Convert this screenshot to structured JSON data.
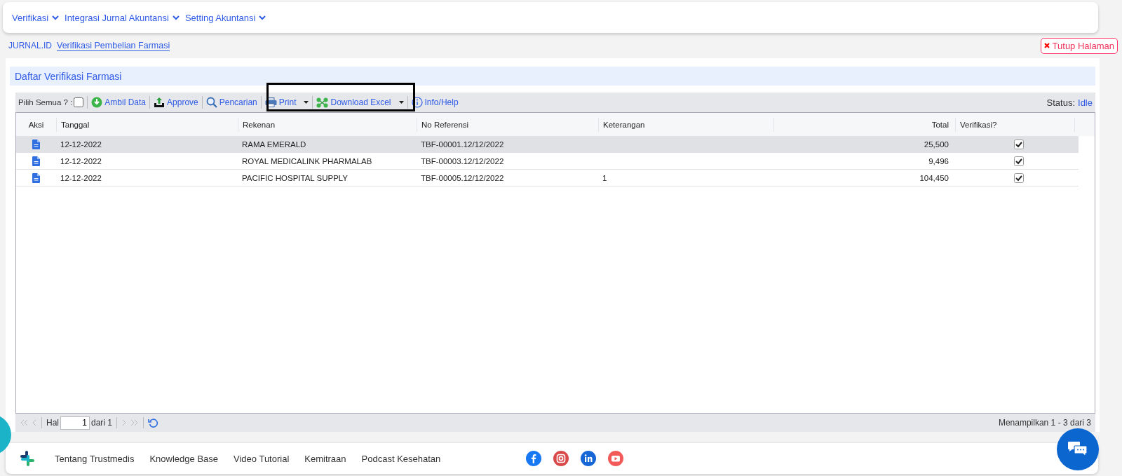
{
  "nav": {
    "menus": [
      {
        "label": "Verifikasi"
      },
      {
        "label": "Integrasi Jurnal Akuntansi"
      },
      {
        "label": "Setting Akuntansi"
      }
    ]
  },
  "breadcrumb": [
    {
      "label": "JURNAL.ID",
      "selected": false
    },
    {
      "label": "Verifikasi Pembelian Farmasi",
      "selected": true
    }
  ],
  "close_button": {
    "label": "Tutup Halaman"
  },
  "panel": {
    "title": "Daftar Verifikasi Farmasi",
    "select_all": {
      "label": "Pilih Semua ? :",
      "checked": false
    },
    "toolbar": [
      {
        "label": "Ambil Data",
        "dropdown": false
      },
      {
        "label": "Approve",
        "dropdown": false
      },
      {
        "label": "Pencarian",
        "dropdown": false
      },
      {
        "label": "Print",
        "dropdown": true
      },
      {
        "label": "Download Excel",
        "dropdown": true
      },
      {
        "label": "Info/Help",
        "dropdown": false
      }
    ],
    "status": {
      "label": "Status:",
      "value": "Idle"
    },
    "columns": [
      "Aksi",
      "Tanggal",
      "Rekenan",
      "No Referensi",
      "Keterangan",
      "Total",
      "Verifikasi?"
    ],
    "rows": [
      {
        "tanggal": "12-12-2022",
        "rekenan": "RAMA EMERALD",
        "no_referensi": "TBF-00001.12/12/2022",
        "keterangan": "",
        "total": "25,500",
        "verified": true,
        "selected": true
      },
      {
        "tanggal": "12-12-2022",
        "rekenan": "ROYAL MEDICALINK PHARMALAB",
        "no_referensi": "TBF-00003.12/12/2022",
        "keterangan": "",
        "total": "9,496",
        "verified": true,
        "selected": false
      },
      {
        "tanggal": "12-12-2022",
        "rekenan": "PACIFIC HOSPITAL SUPPLY",
        "no_referensi": "TBF-00005.12/12/2022",
        "keterangan": "1",
        "total": "104,450",
        "verified": true,
        "selected": false
      }
    ],
    "pager": {
      "page_label": "Hal",
      "page": "1",
      "of": "dari 1",
      "summary": "Menampilkan 1 - 3 dari 3"
    }
  },
  "footer": {
    "links": [
      "Tentang Trustmedis",
      "Knowledge Base",
      "Video Tutorial",
      "Kemitraan",
      "Podcast Kesehatan"
    ]
  }
}
